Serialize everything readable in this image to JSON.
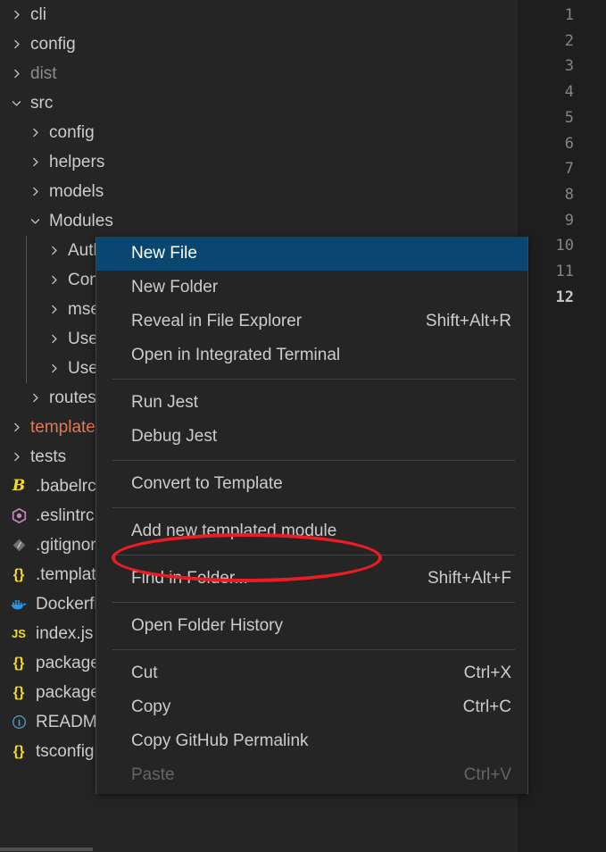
{
  "explorer": {
    "items": [
      {
        "type": "folder",
        "label": "cli",
        "indent": 0,
        "expanded": false,
        "state": "normal"
      },
      {
        "type": "folder",
        "label": "config",
        "indent": 0,
        "expanded": false,
        "state": "normal"
      },
      {
        "type": "folder",
        "label": "dist",
        "indent": 0,
        "expanded": false,
        "state": "dim"
      },
      {
        "type": "folder",
        "label": "src",
        "indent": 0,
        "expanded": true,
        "state": "normal"
      },
      {
        "type": "folder",
        "label": "config",
        "indent": 1,
        "expanded": false,
        "state": "normal"
      },
      {
        "type": "folder",
        "label": "helpers",
        "indent": 1,
        "expanded": false,
        "state": "normal"
      },
      {
        "type": "folder",
        "label": "models",
        "indent": 1,
        "expanded": false,
        "state": "normal"
      },
      {
        "type": "folder",
        "label": "Modules",
        "indent": 1,
        "expanded": true,
        "state": "normal"
      },
      {
        "type": "folder",
        "label": "Auth",
        "indent": 2,
        "expanded": false,
        "state": "normal"
      },
      {
        "type": "folder",
        "label": "Comm",
        "indent": 2,
        "expanded": false,
        "state": "normal"
      },
      {
        "type": "folder",
        "label": "mserv",
        "indent": 2,
        "expanded": false,
        "state": "normal"
      },
      {
        "type": "folder",
        "label": "UserI",
        "indent": 2,
        "expanded": false,
        "state": "normal"
      },
      {
        "type": "folder",
        "label": "Users",
        "indent": 2,
        "expanded": false,
        "state": "normal"
      },
      {
        "type": "folder",
        "label": "routes",
        "indent": 1,
        "expanded": false,
        "state": "normal"
      },
      {
        "type": "folder",
        "label": "templates",
        "indent": 0,
        "expanded": false,
        "state": "modified"
      },
      {
        "type": "folder",
        "label": "tests",
        "indent": 0,
        "expanded": false,
        "state": "normal"
      },
      {
        "type": "file",
        "label": ".babelrc",
        "indent": 0,
        "icon": "babel-icon"
      },
      {
        "type": "file",
        "label": ".eslintrc.js",
        "indent": 0,
        "icon": "eslint-icon"
      },
      {
        "type": "file",
        "label": ".gitignore",
        "indent": 0,
        "icon": "git-icon"
      },
      {
        "type": "file",
        "label": ".templates",
        "indent": 0,
        "icon": "json-icon"
      },
      {
        "type": "file",
        "label": "Dockerfile",
        "indent": 0,
        "icon": "docker-icon"
      },
      {
        "type": "file",
        "label": "index.js",
        "indent": 0,
        "icon": "javascript-icon"
      },
      {
        "type": "file",
        "label": "package.json",
        "indent": 0,
        "icon": "json-icon"
      },
      {
        "type": "file",
        "label": "package-lock.json",
        "indent": 0,
        "icon": "json-icon"
      },
      {
        "type": "file",
        "label": "README.md",
        "indent": 0,
        "icon": "info-icon"
      },
      {
        "type": "file",
        "label": "tsconfig.json",
        "indent": 0,
        "icon": "json-icon"
      }
    ]
  },
  "editor": {
    "line_numbers": [
      "1",
      "2",
      "3",
      "4",
      "5",
      "6",
      "7",
      "8",
      "9",
      "10",
      "11",
      "12"
    ],
    "active_line": "12"
  },
  "context_menu": {
    "groups": [
      {
        "items": [
          {
            "label": "New File",
            "shortcut": "",
            "selected": true,
            "disabled": false
          },
          {
            "label": "New Folder",
            "shortcut": "",
            "selected": false,
            "disabled": false
          },
          {
            "label": "Reveal in File Explorer",
            "shortcut": "Shift+Alt+R",
            "selected": false,
            "disabled": false
          },
          {
            "label": "Open in Integrated Terminal",
            "shortcut": "",
            "selected": false,
            "disabled": false
          }
        ]
      },
      {
        "items": [
          {
            "label": "Run Jest",
            "shortcut": "",
            "selected": false,
            "disabled": false
          },
          {
            "label": "Debug Jest",
            "shortcut": "",
            "selected": false,
            "disabled": false
          }
        ]
      },
      {
        "items": [
          {
            "label": "Convert to Template",
            "shortcut": "",
            "selected": false,
            "disabled": false
          }
        ]
      },
      {
        "items": [
          {
            "label": "Add new templated module",
            "shortcut": "",
            "selected": false,
            "disabled": false
          }
        ]
      },
      {
        "items": [
          {
            "label": "Find in Folder...",
            "shortcut": "Shift+Alt+F",
            "selected": false,
            "disabled": false
          }
        ]
      },
      {
        "items": [
          {
            "label": "Open Folder History",
            "shortcut": "",
            "selected": false,
            "disabled": false
          }
        ]
      },
      {
        "items": [
          {
            "label": "Cut",
            "shortcut": "Ctrl+X",
            "selected": false,
            "disabled": false
          },
          {
            "label": "Copy",
            "shortcut": "Ctrl+C",
            "selected": false,
            "disabled": false
          },
          {
            "label": "Copy GitHub Permalink",
            "shortcut": "",
            "selected": false,
            "disabled": false
          },
          {
            "label": "Paste",
            "shortcut": "Ctrl+V",
            "selected": false,
            "disabled": true
          }
        ]
      }
    ]
  },
  "annotation": {
    "shape": "ellipse",
    "color": "#ed1c24",
    "targets": "Add new templated module"
  },
  "colors": {
    "sidebar_background": "#252526",
    "editor_background": "#1e1e1e",
    "menu_background": "#252526",
    "menu_border": "#454545",
    "selection_blue": "#094771",
    "text": "#cccccc",
    "text_dim": "#8c8c8c",
    "text_disabled": "#656565",
    "modified_folder": "#e2795b",
    "line_number": "#858585",
    "line_number_active": "#c6c6c6",
    "annotation_red": "#ed1c24"
  }
}
